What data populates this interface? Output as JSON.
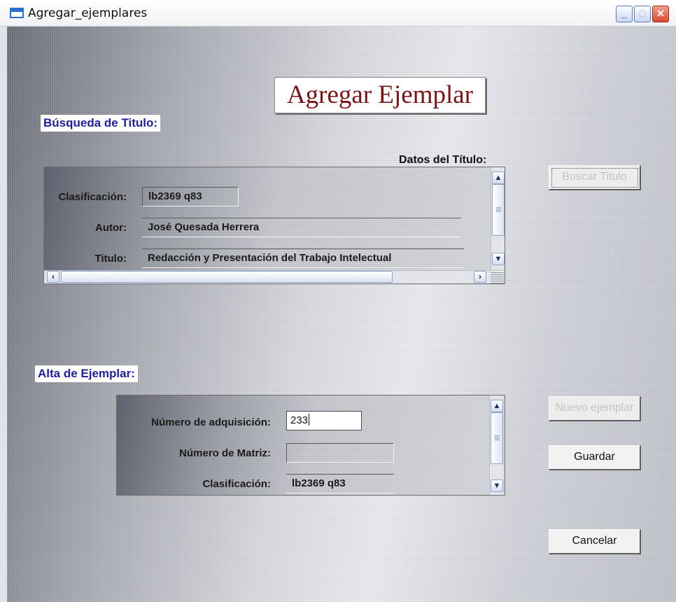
{
  "window": {
    "title": "Agregar_ejemplares",
    "controls": {
      "minimize": "_",
      "maximize": "□",
      "close": "✕"
    }
  },
  "header": {
    "title": "Agregar Ejemplar"
  },
  "busqueda": {
    "section_label": "Búsqueda de Titulo:",
    "datos_label": "Datos del Título:",
    "fields": {
      "clasificacion": {
        "label": "Clasificación:",
        "value": "lb2369 q83"
      },
      "autor": {
        "label": "Autor:",
        "value": "José Quesada Herrera"
      },
      "titulo": {
        "label": "Titulo:",
        "value": "Redacción y Presentación del Trabajo Intelectual"
      }
    },
    "buscar_button": "Buscar Titulo"
  },
  "alta": {
    "section_label": "Alta de Ejemplar:",
    "fields": {
      "numero_adquisicion": {
        "label": "Número de adquisición:",
        "value": "233"
      },
      "numero_matriz": {
        "label": "Número de Matriz:",
        "value": ""
      },
      "clasificacion": {
        "label": "Clasificación:",
        "value": "lb2369 q83"
      }
    },
    "nuevo_button": "Nuevo ejemplar",
    "guardar_button": "Guardar",
    "cancelar_button": "Cancelar"
  },
  "icons": {
    "scroll_up": "▲",
    "scroll_down": "▼",
    "scroll_left": "‹",
    "scroll_right": "›"
  }
}
